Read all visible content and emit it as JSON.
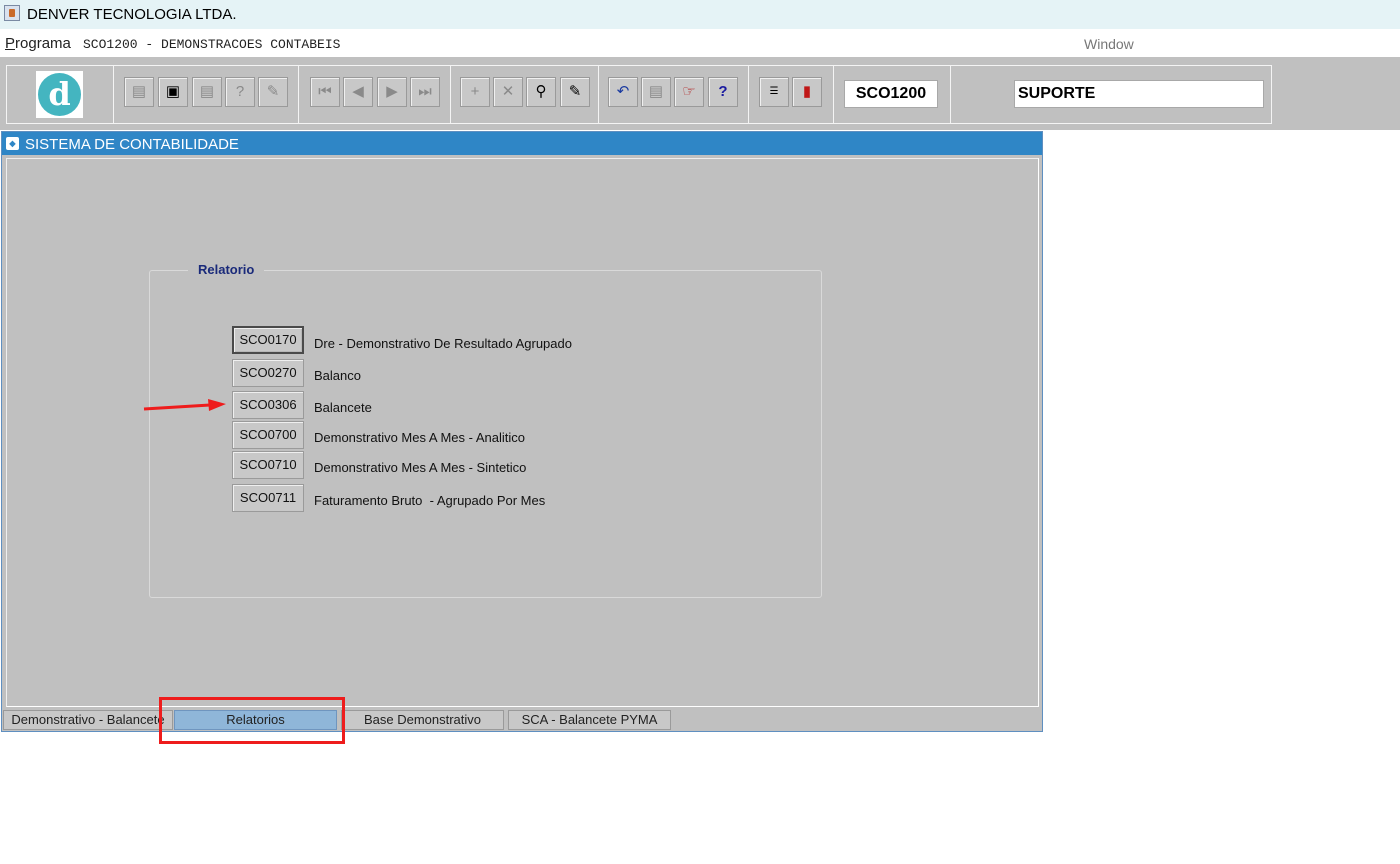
{
  "window_title": "DENVER TECNOLOGIA LTDA.",
  "menu": {
    "programa": "Programa",
    "program_name": "SCO1200 - DEMONSTRACOES CONTABEIS",
    "window": "Window"
  },
  "toolbar": {
    "logo_letter": "d",
    "program_code": "SCO1200",
    "user": "SUPORTE",
    "icons": [
      "save-icon",
      "window-icon",
      "print-icon",
      "query-icon",
      "edit-icon",
      "first-record-icon",
      "previous-record-icon",
      "next-record-icon",
      "last-record-icon",
      "insert-record-icon",
      "delete-record-icon",
      "search-record-icon",
      "clear-icon",
      "undo-icon",
      "clipboard-icon",
      "help-list-icon",
      "help-icon",
      "menu-icon",
      "exit-icon"
    ]
  },
  "module_window": {
    "title": "SISTEMA DE CONTABILIDADE"
  },
  "group": {
    "title": "Relatorio",
    "items": [
      {
        "code": "SCO0170",
        "label": "Dre - Demonstrativo De Resultado Agrupado"
      },
      {
        "code": "SCO0270",
        "label": "Balanco"
      },
      {
        "code": "SCO0306",
        "label": "Balancete"
      },
      {
        "code": "SCO0700",
        "label": "Demonstrativo Mes A Mes - Analitico"
      },
      {
        "code": "SCO0710",
        "label": "Demonstrativo Mes A Mes - Sintetico"
      },
      {
        "code": "SCO0711",
        "label": "Faturamento Bruto  - Agrupado Por Mes"
      }
    ]
  },
  "tabs": [
    {
      "label": "Demonstrativo - Balancete",
      "active": false
    },
    {
      "label": "Relatorios",
      "active": true
    },
    {
      "label": "Base Demonstrativo",
      "active": false
    },
    {
      "label": "SCA - Balancete PYMA",
      "active": false
    }
  ],
  "annotations": {
    "arrow_color": "#ee1c1c",
    "highlight_color": "#ee1c1c"
  },
  "colors": {
    "title_bar": "#2f86c6",
    "active_tab": "#8fb6d9",
    "panel": "#c0c0c0"
  }
}
